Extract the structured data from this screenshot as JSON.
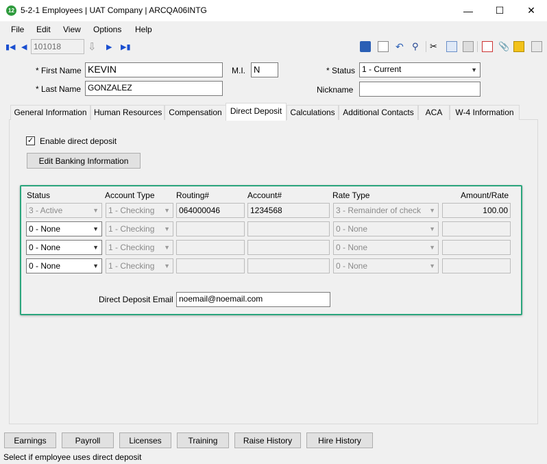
{
  "window": {
    "app_icon_text": "12",
    "title": "5-2-1 Employees | UAT Company | ARCQA06INTG",
    "minimize": "—",
    "maximize": "☐",
    "close": "✕"
  },
  "menu": [
    "File",
    "Edit",
    "View",
    "Options",
    "Help"
  ],
  "toolbar": {
    "record_id": "101018"
  },
  "form": {
    "first_name_label": "* First Name",
    "first_name": "KEVIN",
    "mi_label": "M.I.",
    "mi": "N",
    "status_label": "* Status",
    "status": "1 - Current",
    "last_name_label": "* Last Name",
    "last_name": "GONZALEZ",
    "nickname_label": "Nickname",
    "nickname": ""
  },
  "tabs": [
    "General Information",
    "Human Resources",
    "Compensation",
    "Direct Deposit",
    "Calculations",
    "Additional Contacts",
    "ACA",
    "W-4 Information"
  ],
  "active_tab": "Direct Deposit",
  "direct_deposit": {
    "enable_label": "Enable direct deposit",
    "enabled": true,
    "edit_banking_button": "Edit Banking Information",
    "columns": {
      "status": "Status",
      "account_type": "Account Type",
      "routing": "Routing#",
      "account": "Account#",
      "rate_type": "Rate Type",
      "amount": "Amount/Rate"
    },
    "rows": [
      {
        "status": "3 - Active",
        "account_type": "1 - Checking",
        "routing": "064000046",
        "account": "1234568",
        "rate_type": "3 - Remainder of check",
        "amount": "100.00"
      },
      {
        "status": "0 - None",
        "account_type": "1 - Checking",
        "routing": "",
        "account": "",
        "rate_type": "0 - None",
        "amount": ""
      },
      {
        "status": "0 - None",
        "account_type": "1 - Checking",
        "routing": "",
        "account": "",
        "rate_type": "0 - None",
        "amount": ""
      },
      {
        "status": "0 - None",
        "account_type": "1 - Checking",
        "routing": "",
        "account": "",
        "rate_type": "0 - None",
        "amount": ""
      }
    ],
    "email_label": "Direct Deposit Email",
    "email": "noemail@noemail.com",
    "highlight_color": "#2aa57c"
  },
  "bottom_buttons": [
    "Earnings",
    "Payroll",
    "Licenses",
    "Training",
    "Raise History",
    "Hire History"
  ],
  "status_bar": "Select if employee uses direct deposit"
}
